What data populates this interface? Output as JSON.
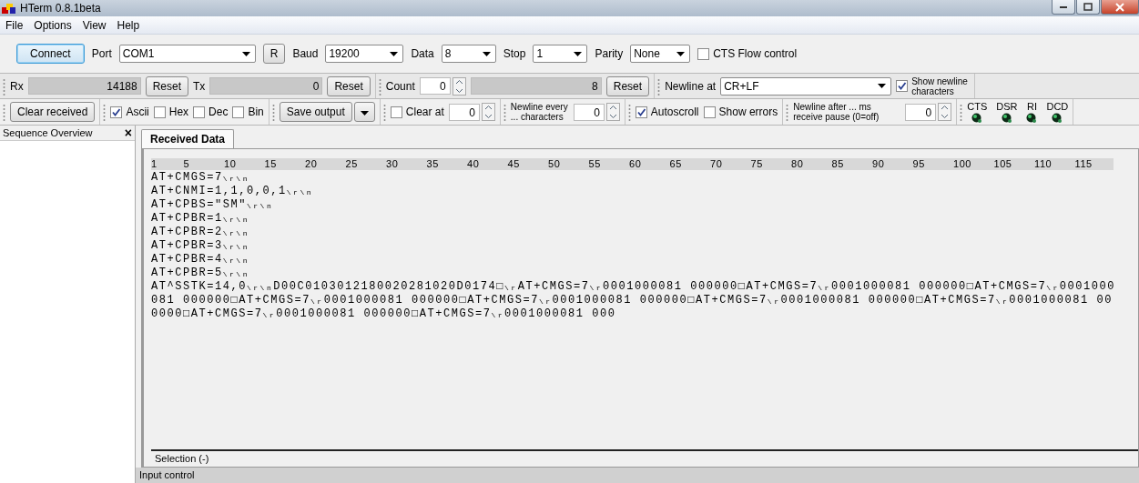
{
  "window": {
    "title": "HTerm 0.8.1beta"
  },
  "menu": [
    "File",
    "Options",
    "View",
    "Help"
  ],
  "toolbars": [
    {
      "groups": [
        [
          {
            "kind": "primary_button",
            "label": "Connect"
          },
          {
            "kind": "label",
            "text": "Port"
          },
          {
            "kind": "combo",
            "value": "COM1"
          },
          {
            "kind": "button",
            "label": "R"
          },
          {
            "kind": "label",
            "text": "Baud"
          },
          {
            "kind": "combo",
            "value": "19200"
          },
          {
            "kind": "label",
            "text": "Data"
          },
          {
            "kind": "combo",
            "value": "8"
          },
          {
            "kind": "label",
            "text": "Stop"
          },
          {
            "kind": "combo",
            "value": "1"
          },
          {
            "kind": "label",
            "text": "Parity"
          },
          {
            "kind": "combo",
            "value": "None"
          },
          {
            "kind": "checkbox",
            "label": "CTS Flow control",
            "checked": false
          }
        ]
      ]
    },
    {
      "groups": [
        [
          {
            "kind": "label",
            "text": "Rx"
          },
          {
            "kind": "readout",
            "value": "14188"
          },
          {
            "kind": "button",
            "label": "Reset"
          },
          {
            "kind": "label",
            "text": "Tx"
          },
          {
            "kind": "readout",
            "value": "0"
          },
          {
            "kind": "button",
            "label": "Reset"
          }
        ],
        [
          {
            "kind": "label",
            "text": "Count"
          },
          {
            "kind": "spinner",
            "value": "0"
          },
          {
            "kind": "readout",
            "value": "8"
          },
          {
            "kind": "button",
            "label": "Reset"
          }
        ],
        [
          {
            "kind": "label",
            "text": "Newline at"
          },
          {
            "kind": "combo",
            "value": "CR+LF"
          },
          {
            "kind": "note_checkbox",
            "label": "Show newline characters",
            "checked": true
          }
        ]
      ]
    },
    {
      "groups": [
        [
          {
            "kind": "button",
            "label": "Clear received"
          }
        ],
        [
          {
            "kind": "checkbox",
            "label": "Ascii",
            "checked": true
          },
          {
            "kind": "checkbox",
            "label": "Hex",
            "checked": false
          },
          {
            "kind": "checkbox",
            "label": "Dec",
            "checked": false
          },
          {
            "kind": "checkbox",
            "label": "Bin",
            "checked": false
          }
        ],
        [
          {
            "kind": "button",
            "label": "Save output"
          },
          {
            "kind": "dropbutton"
          }
        ],
        [
          {
            "kind": "checkbox",
            "label": "Clear at",
            "checked": false
          },
          {
            "kind": "spinner",
            "value": "0"
          }
        ],
        [
          {
            "kind": "note",
            "text": "Newline every ... characters"
          },
          {
            "kind": "spinner",
            "value": "0"
          }
        ],
        [
          {
            "kind": "checkbox",
            "label": "Autoscroll",
            "checked": true
          },
          {
            "kind": "checkbox",
            "label": "Show errors",
            "checked": false
          }
        ],
        [
          {
            "kind": "note",
            "text": "Newline after ... ms receive pause (0=off)"
          },
          {
            "kind": "spinner",
            "value": "0"
          }
        ],
        [
          {
            "kind": "leds",
            "leds": [
              "CTS",
              "DSR",
              "RI",
              "DCD"
            ]
          }
        ]
      ]
    }
  ],
  "sidebar": {
    "title": "Sequence Overview",
    "close": "×"
  },
  "tabs": [
    {
      "label": "Received Data",
      "selected": true
    }
  ],
  "ruler": [
    "1",
    "5",
    "10",
    "15",
    "20",
    "25",
    "30",
    "35",
    "40",
    "45",
    "50",
    "55",
    "60",
    "65",
    "70",
    "75",
    "80",
    "85",
    "90",
    "95",
    "100",
    "105",
    "110",
    "115"
  ],
  "received_lines": [
    "AT+CMGS=7$_{\\r\\n}$",
    "AT+CNMI=1,1,0,0,1$_{\\r\\n}$",
    "AT+CPBS=\"SM\"$_{\\r\\n}$",
    "AT+CPBR=1$_{\\r\\n}$",
    "AT+CPBR=2$_{\\r\\n}$",
    "AT+CPBR=3$_{\\r\\n}$",
    "AT+CPBR=4$_{\\r\\n}$",
    "AT+CPBR=5$_{\\r\\n}$",
    "AT^SSTK=14,0$_{\\r\\n}$D00C0103012180020281020D0174□$_{\\r}$AT+CMGS=7$_{\\r}$0001000081 000000□AT+CMGS=7$_{\\r}$0001000081 000000□AT+CMGS=7$_{\\r}$0001000",
    "081 000000□AT+CMGS=7$_{\\r}$0001000081 000000□AT+CMGS=7$_{\\r}$0001000081 000000□AT+CMGS=7$_{\\r}$0001000081 000000□AT+CMGS=7$_{\\r}$0001000081 00",
    "0000□AT+CMGS=7$_{\\r}$0001000081 000000□AT+CMGS=7$_{\\r}$0001000081 000"
  ],
  "selection": "Selection (-)",
  "input_panel": {
    "title": "Input control"
  }
}
